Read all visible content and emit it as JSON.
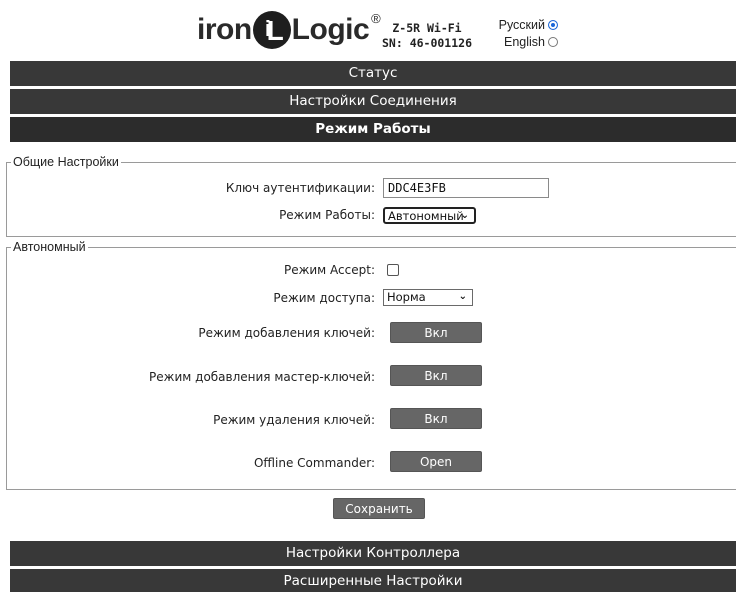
{
  "header": {
    "logo_text_left": "iron",
    "logo_mark_i": "i",
    "logo_mark_L": "L",
    "logo_text_right": "Logic",
    "logo_reg": "®",
    "device_model": "Z-5R Wi-Fi",
    "device_sn": "SN: 46-001126",
    "languages": [
      {
        "label": "Русский",
        "selected": true
      },
      {
        "label": "English",
        "selected": false
      }
    ]
  },
  "nav": {
    "status": "Статус",
    "connection": "Настройки Соединения",
    "mode": "Режим Работы",
    "controller": "Настройки Контроллера",
    "advanced": "Расширенные Настройки"
  },
  "general": {
    "legend": "Общие Настройки",
    "auth_key_label": "Ключ аутентификации:",
    "auth_key_value": "DDC4E3FB",
    "work_mode_label": "Режим Работы:",
    "work_mode_value": "Автономный"
  },
  "autonomous": {
    "legend": "Автономный",
    "accept_label": "Режим Accept:",
    "accept_checked": false,
    "access_label": "Режим доступа:",
    "access_value": "Норма",
    "add_keys_label": "Режим добавления ключей:",
    "add_keys_btn": "Вкл",
    "add_master_label": "Режим добавления мастер-ключей:",
    "add_master_btn": "Вкл",
    "delete_keys_label": "Режим удаления ключей:",
    "delete_keys_btn": "Вкл",
    "offline_label": "Offline Commander:",
    "offline_btn": "Open"
  },
  "save_label": "Сохранить",
  "colors": {
    "bar": "#383838",
    "button": "#666666",
    "radio_selected": "#1a66d8"
  }
}
